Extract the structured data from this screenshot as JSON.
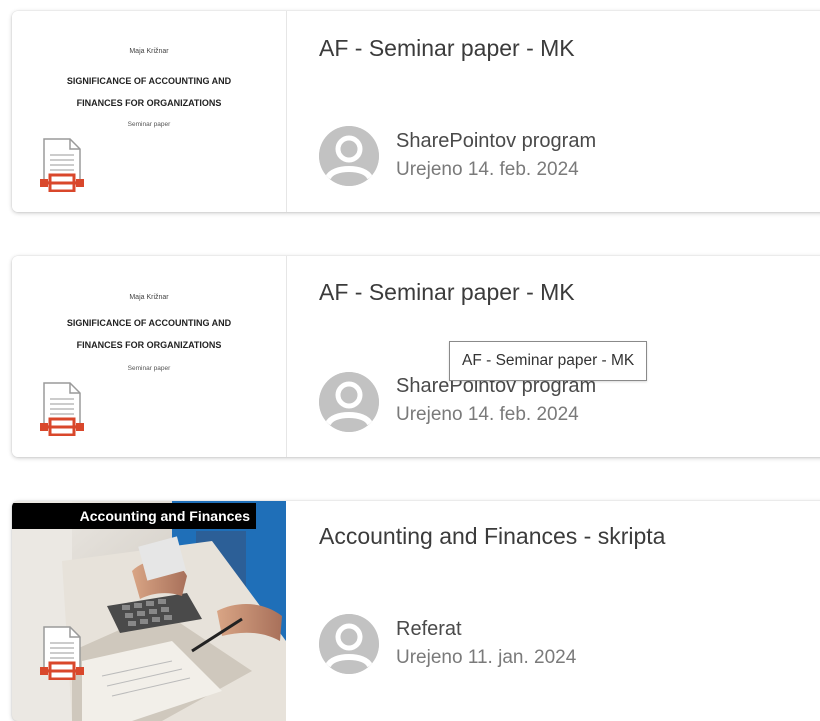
{
  "cards": [
    {
      "title": "AF - Seminar paper - MK",
      "owner": "SharePointov program",
      "edited": "Urejeno 14. feb. 2024",
      "thumbnail": {
        "author": "Maja Križnar",
        "title_line1": "SIGNIFICANCE OF ACCOUNTING AND",
        "title_line2": "FINANCES FOR ORGANIZATIONS",
        "subtitle": "Seminar paper"
      }
    },
    {
      "title": "AF - Seminar paper - MK",
      "owner": "SharePointov program",
      "edited": "Urejeno 14. feb. 2024",
      "thumbnail": {
        "author": "Maja Križnar",
        "title_line1": "SIGNIFICANCE OF ACCOUNTING AND",
        "title_line2": "FINANCES FOR ORGANIZATIONS",
        "subtitle": "Seminar paper"
      }
    },
    {
      "title": "Accounting and Finances - skripta",
      "owner": "Referat",
      "edited": "Urejeno 11. jan. 2024",
      "thumbnail": {
        "banner": "Accounting and Finances"
      }
    }
  ],
  "tooltip": "AF - Seminar paper - MK",
  "icons": {
    "file": "presentation-file-icon",
    "avatar": "person-avatar-icon"
  },
  "colors": {
    "file_icon_accent": "#d9472b",
    "photo_blue": "#1f6fb8"
  }
}
